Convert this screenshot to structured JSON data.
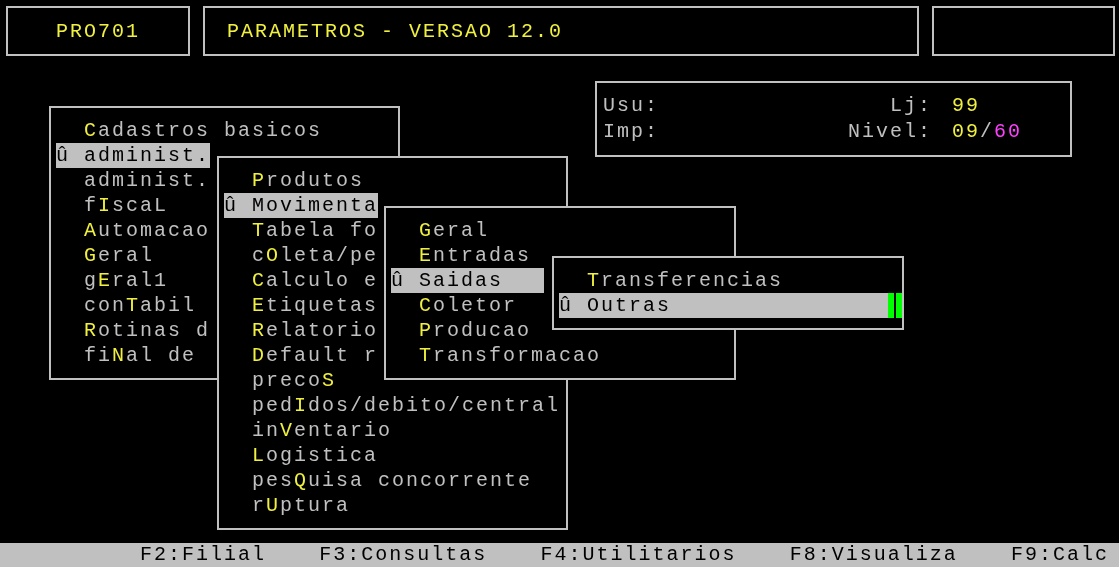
{
  "header": {
    "program": "PRO701",
    "title": "PARAMETROS - VERSAO 12.0"
  },
  "info": {
    "user_label": "Usu:",
    "printer_label": "Imp:",
    "store_label": "Lj:",
    "store": "99",
    "nivel_label": "Nivel:",
    "nivel_current": "09",
    "nivel_separator": "/",
    "nivel_max": "60"
  },
  "menus": [
    {
      "cursor": false,
      "items": [
        {
          "selected": false,
          "key": "C",
          "post": "adastros basicos"
        },
        {
          "selected": true,
          "marker": "û",
          "pre": "administ."
        },
        {
          "selected": false,
          "pre": "administ."
        },
        {
          "selected": false,
          "pre": "f",
          "key": "I",
          "post": "scaL"
        },
        {
          "selected": false,
          "key": "A",
          "post": "utomacao"
        },
        {
          "selected": false,
          "key": "G",
          "post": "eral"
        },
        {
          "selected": false,
          "pre": "g",
          "key": "E",
          "post": "ral1"
        },
        {
          "selected": false,
          "pre": "con",
          "key": "T",
          "post": "abil"
        },
        {
          "selected": false,
          "key": "R",
          "post": "otinas d"
        },
        {
          "selected": false,
          "pre": "fi",
          "key": "N",
          "post": "al de"
        }
      ]
    },
    {
      "cursor": false,
      "items": [
        {
          "selected": false,
          "key": "P",
          "post": "rodutos"
        },
        {
          "selected": true,
          "marker": "û",
          "pre": "Movimenta"
        },
        {
          "selected": false,
          "key": "T",
          "post": "abela fo"
        },
        {
          "selected": false,
          "pre": "c",
          "key": "O",
          "post": "leta/pe"
        },
        {
          "selected": false,
          "key": "C",
          "post": "alculo e"
        },
        {
          "selected": false,
          "key": "E",
          "post": "tiquetas"
        },
        {
          "selected": false,
          "key": "R",
          "post": "elatorio"
        },
        {
          "selected": false,
          "key": "D",
          "post": "efault r"
        },
        {
          "selected": false,
          "pre": "preco",
          "key": "S"
        },
        {
          "selected": false,
          "pre": "ped",
          "key": "I",
          "post": "dos/debito/central"
        },
        {
          "selected": false,
          "pre": "in",
          "key": "V",
          "post": "entario"
        },
        {
          "selected": false,
          "key": "L",
          "post": "ogistica"
        },
        {
          "selected": false,
          "pre": "pes",
          "key": "Q",
          "post": "uisa concorrente"
        },
        {
          "selected": false,
          "pre": "r",
          "key": "U",
          "post": "ptura"
        }
      ]
    },
    {
      "cursor": false,
      "items": [
        {
          "selected": false,
          "key": "G",
          "post": "eral"
        },
        {
          "selected": false,
          "key": "E",
          "post": "ntradas"
        },
        {
          "selected": true,
          "marker": "û",
          "pre": "Saidas"
        },
        {
          "selected": false,
          "key": "C",
          "post": "oletor"
        },
        {
          "selected": false,
          "key": "P",
          "post": "roducao"
        },
        {
          "selected": false,
          "key": "T",
          "post": "ransformacao"
        }
      ]
    },
    {
      "cursor": true,
      "items": [
        {
          "selected": false,
          "key": "T",
          "post": "ransferencias"
        },
        {
          "selected": true,
          "marker": "û",
          "pre": "Outras"
        }
      ]
    }
  ],
  "function_keys": [
    "F2:Filial",
    "F3:Consultas",
    "F4:Utilitarios",
    "F8:Visualiza",
    "F9:Calc"
  ]
}
